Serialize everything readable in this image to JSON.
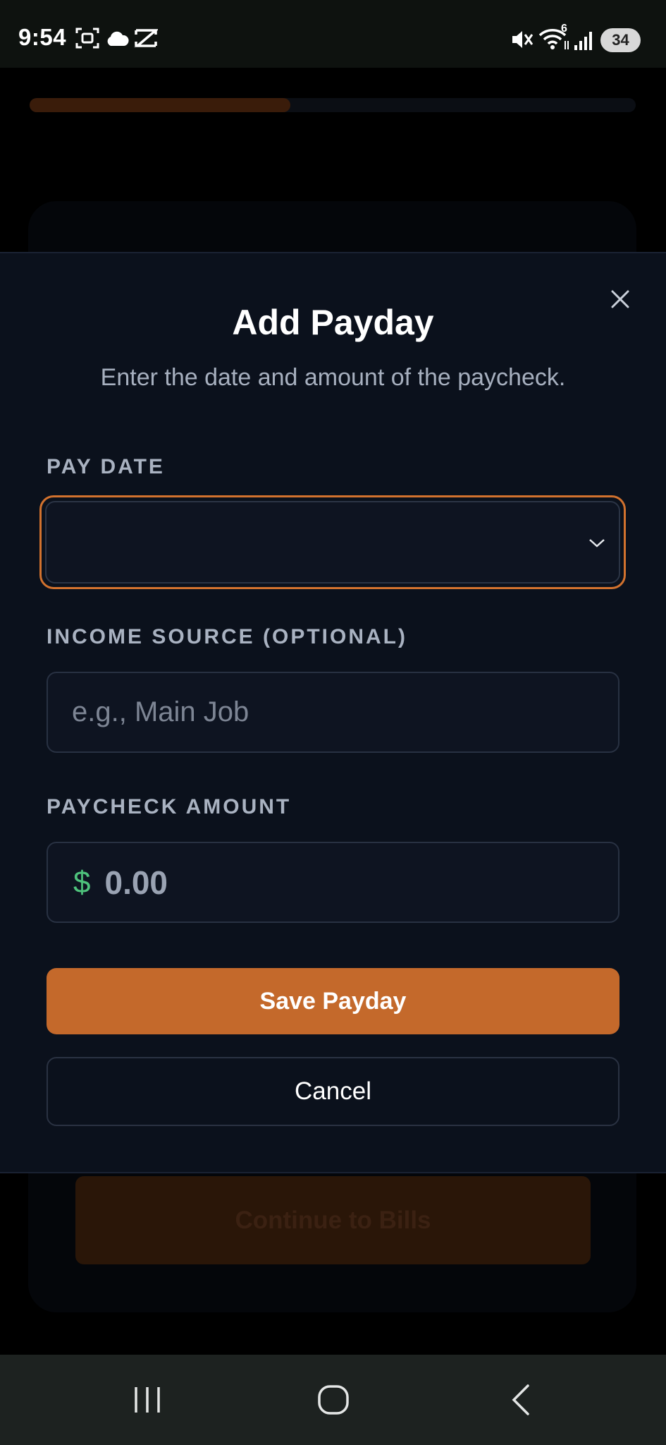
{
  "status_bar": {
    "time": "9:54",
    "battery_level": "34",
    "icons": [
      "screenshot-icon",
      "cloud-icon",
      "capcut-icon",
      "mute-icon",
      "wifi-icon",
      "signal-icon",
      "battery-icon"
    ],
    "wifi_badge": "6"
  },
  "background": {
    "progress_fraction": 0.43,
    "continue_label": "Continue to Bills",
    "accent_dim": "#2a1608"
  },
  "modal": {
    "title": "Add Payday",
    "subtitle": "Enter the date and amount of the paycheck.",
    "close_icon": "close-icon",
    "pay_date": {
      "label": "PAY DATE",
      "value": ""
    },
    "income_source": {
      "label": "INCOME SOURCE (OPTIONAL)",
      "placeholder": "e.g., Main Job",
      "value": ""
    },
    "paycheck_amount": {
      "label": "PAYCHECK AMOUNT",
      "currency_symbol": "$",
      "placeholder": "0.00",
      "value": ""
    },
    "save_label": "Save Payday",
    "cancel_label": "Cancel"
  },
  "colors": {
    "accent": "#c4692b",
    "focus_ring": "#d2722e",
    "currency": "#4ec27c",
    "modal_bg": "#0b111c"
  },
  "nav_bar": {
    "icons": [
      "recent-apps-icon",
      "home-icon",
      "back-icon"
    ]
  }
}
